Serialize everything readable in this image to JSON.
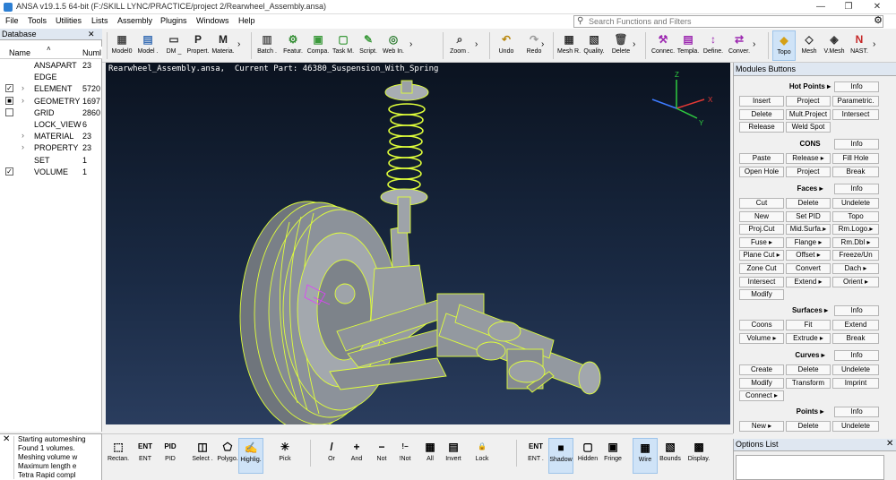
{
  "title_bar": {
    "text": "ANSA v19.1.5 64-bit (F:/SKILL LYNC/PRACTICE/project 2/Rearwheel_Assembly.ansa)"
  },
  "menu": [
    "File",
    "Tools",
    "Utilities",
    "Lists",
    "Assembly",
    "Plugins",
    "Windows",
    "Help"
  ],
  "search": {
    "placeholder": "Search Functions and Filters"
  },
  "toolbar": [
    {
      "label": "Model0",
      "icon": "grid-icon",
      "color": "#4a4a4a"
    },
    {
      "label": "Model .",
      "icon": "model-icon",
      "color": "#3a6fb5"
    },
    {
      "label": "DM _",
      "icon": "dm-icon",
      "color": "#333333"
    },
    {
      "label": "Propert.",
      "icon": "p-icon",
      "color": "#222222"
    },
    {
      "label": "Materia.",
      "icon": "m-icon",
      "color": "#222222"
    },
    {
      "label": "Batch .",
      "icon": "batch-icon",
      "color": "#555555"
    },
    {
      "label": "Featur.",
      "icon": "gear-icon",
      "color": "#2e8b2e"
    },
    {
      "label": "Compa.",
      "icon": "compare-icon",
      "color": "#3c9a3c"
    },
    {
      "label": "Task M.",
      "icon": "task-icon",
      "color": "#3c9a3c"
    },
    {
      "label": "Script.",
      "icon": "script-icon",
      "color": "#3c9a3c"
    },
    {
      "label": "Web In.",
      "icon": "web-icon",
      "color": "#2e7d32"
    },
    {
      "label": "Zoom .",
      "icon": "zoom-icon",
      "color": "#333333"
    },
    {
      "label": "Undo",
      "icon": "undo-icon",
      "color": "#b8860b"
    },
    {
      "label": "Redo",
      "icon": "redo-icon",
      "color": "#999999"
    },
    {
      "label": "Mesh R.",
      "icon": "mesh-r-icon",
      "color": "#333333"
    },
    {
      "label": "Quality.",
      "icon": "quality-icon",
      "color": "#333333"
    },
    {
      "label": "Delete",
      "icon": "delete-icon",
      "color": "#444444"
    },
    {
      "label": "Connec.",
      "icon": "connect-icon",
      "color": "#9c27b0"
    },
    {
      "label": "Templa.",
      "icon": "template-icon",
      "color": "#9c27b0"
    },
    {
      "label": "Define.",
      "icon": "define-icon",
      "color": "#9c27b0"
    },
    {
      "label": "Conver.",
      "icon": "convert-icon",
      "color": "#9c27b0"
    },
    {
      "label": "Topo",
      "icon": "topo-icon",
      "color": "#d4a017"
    },
    {
      "label": "Mesh",
      "icon": "mesh-icon",
      "color": "#333333"
    },
    {
      "label": "V.Mesh",
      "icon": "vmesh-icon",
      "color": "#333333"
    },
    {
      "label": "NAST.",
      "icon": "nast-icon",
      "color": "#c62828"
    }
  ],
  "database": {
    "title": "Database",
    "columns": [
      "Name",
      "Numl"
    ],
    "rows": [
      {
        "name": "ANSAPART",
        "count": "23",
        "checkbox": "none",
        "expand": false
      },
      {
        "name": "EDGE",
        "count": "",
        "checkbox": "none",
        "expand": false
      },
      {
        "name": "ELEMENT",
        "count": "5720",
        "checkbox": "checked",
        "expand": true
      },
      {
        "name": "GEOMETRY",
        "count": "1697",
        "checkbox": "partial",
        "expand": true
      },
      {
        "name": "GRID",
        "count": "2860",
        "checkbox": "unchecked",
        "expand": false
      },
      {
        "name": "LOCK_VIEW",
        "count": "6",
        "checkbox": "none",
        "expand": false
      },
      {
        "name": "MATERIAL",
        "count": "23",
        "checkbox": "none",
        "expand": true
      },
      {
        "name": "PROPERTY",
        "count": "23",
        "checkbox": "none",
        "expand": true
      },
      {
        "name": "SET",
        "count": "1",
        "checkbox": "none",
        "expand": false
      },
      {
        "name": "VOLUME",
        "count": "1",
        "checkbox": "checked",
        "expand": false
      }
    ]
  },
  "viewport": {
    "header": "Rearwheel_Assembly.ansa,  Current Part: 46380_Suspension_With_Spring",
    "axis_x": "X",
    "axis_y": "Y",
    "axis_z": "Z"
  },
  "modules": {
    "title": "Modules Buttons",
    "sections": [
      {
        "title": "Hot Points ▸",
        "info": "Info",
        "buttons": [
          "Insert",
          "Project",
          "Parametric.",
          "Delete",
          "Mult.Project",
          "Intersect",
          "Release",
          "Weld Spot"
        ]
      },
      {
        "title": "CONS",
        "info": "Info",
        "buttons": [
          "Paste",
          "Release ▸",
          "Fill Hole",
          "Open Hole",
          "Project",
          "Break"
        ]
      },
      {
        "title": "Faces ▸",
        "info": "Info",
        "buttons": [
          "Cut",
          "Delete",
          "Undelete",
          "New",
          "Set PID",
          "Topo",
          "Proj.Cut",
          "Mid.Surfa.▸",
          "Rm.Logo.▸",
          "Fuse ▸",
          "Flange ▸",
          "Rm.Dbl ▸",
          "Plane Cut ▸",
          "Offset ▸",
          "Freeze/Un",
          "Zone Cut",
          "Convert",
          "Dach ▸",
          "Intersect",
          "Extend ▸",
          "Orient ▸",
          "Modify"
        ]
      },
      {
        "title": "Surfaces ▸",
        "info": "Info",
        "buttons": [
          "Coons",
          "Fit",
          "Extend",
          "Volume ▸",
          "Extrude ▸",
          "Break"
        ]
      },
      {
        "title": "Curves ▸",
        "info": "Info",
        "buttons": [
          "Create",
          "Delete",
          "Undelete",
          "Modify",
          "Transform",
          "Imprint",
          "Connect ▸"
        ]
      },
      {
        "title": "Points ▸",
        "info": "Info",
        "buttons": [
          "New ▸",
          "Delete",
          "Undelete"
        ]
      }
    ]
  },
  "console": {
    "lines": [
      "Starting automeshing",
      "Found 1 volumes.",
      "Meshing volume w",
      "Maximum length e",
      "Tetra Rapid compl"
    ]
  },
  "bottom_toolbar": [
    {
      "label": "Rectan.",
      "icon": "rectangle-select-icon"
    },
    {
      "label": "ENT",
      "icon": "ent-icon"
    },
    {
      "label": "PID",
      "icon": "pid-icon"
    },
    {
      "label": "Select .",
      "icon": "select-icon"
    },
    {
      "label": "Polygo.",
      "icon": "polygon-icon"
    },
    {
      "label": "Highlig.",
      "icon": "highlight-icon"
    },
    {
      "label": "Pick",
      "icon": "pick-icon"
    },
    {
      "label": "Or",
      "icon": "or-icon"
    },
    {
      "label": "And",
      "icon": "and-icon"
    },
    {
      "label": "Not",
      "icon": "not-icon"
    },
    {
      "label": "!Not",
      "icon": "inot-icon"
    },
    {
      "label": "All",
      "icon": "all-icon"
    },
    {
      "label": "Invert",
      "icon": "invert-icon"
    },
    {
      "label": "Lock",
      "icon": "lock-icon"
    },
    {
      "label": "ENT .",
      "icon": "ent-dropdown-icon"
    },
    {
      "label": "Shadow",
      "icon": "shadow-icon"
    },
    {
      "label": "Hidden",
      "icon": "hidden-icon"
    },
    {
      "label": "Fringe",
      "icon": "fringe-icon"
    },
    {
      "label": "Wire",
      "icon": "wire-icon"
    },
    {
      "label": "Bounds",
      "icon": "bounds-icon"
    },
    {
      "label": "Display.",
      "icon": "display-icon"
    }
  ],
  "options": {
    "title": "Options List"
  }
}
